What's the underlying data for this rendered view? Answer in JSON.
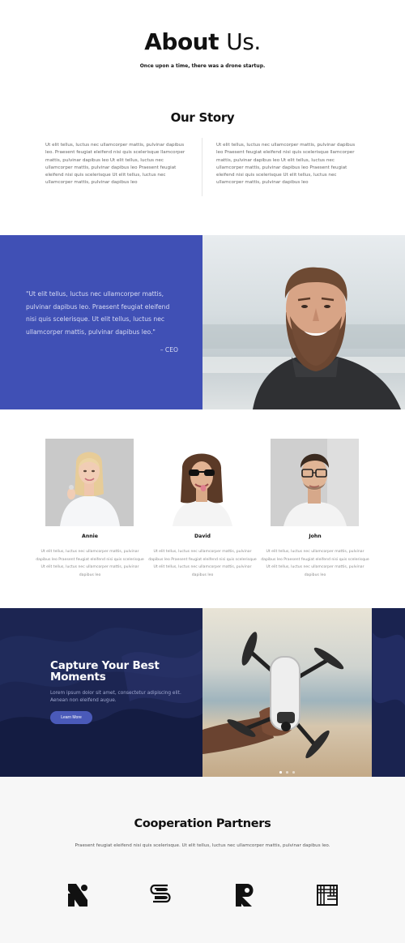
{
  "hero": {
    "title_bold": "About",
    "title_light": "Us.",
    "subtitle": "Once upon a time, there was a drone startup."
  },
  "story": {
    "title": "Our Story",
    "left_paragraph": "Ut elit tellus, luctus nec ullamcorper mattis, pulvinar dapibus leo. Praesent feugiat eleifend nisi quis scelerisque llamcorper mattis, pulvinar dapibus leo Ut elit tellus, luctus nec ullamcorper mattis, pulvinar dapibus leo Praesent feugiat eleifend nisi quis scelerisque Ut elit tellus, luctus nec ullamcorper mattis, pulvinar dapibus leo",
    "right_paragraph": "Ut elit tellus, luctus nec ullamcorper mattis, pulvinar dapibus leo Praesent feugiat eleifend nisi quis scelerisque llamcorper mattis, pulvinar dapibus leo Ut elit tellus, luctus nec ullamcorper mattis, pulvinar dapibus leo Praesent feugiat eleifend nisi quis scelerisque Ut elit tellus, luctus nec ullamcorper mattis, pulvinar dapibus leo"
  },
  "quote": {
    "text": "\"Ut elit tellus, luctus nec ullamcorper mattis, pulvinar dapibus leo. Praesent feugiat eleifend nisi quis scelerisque. Ut elit tellus, luctus nec ullamcorper mattis, pulvinar dapibus leo.\"",
    "author": "– CEO",
    "panel_color": "#4050b5"
  },
  "team": [
    {
      "name": "Annie",
      "bio": "Ut elit tellus, luctus nec ullamcorper mattis, pulvinar dapibus leo Praesent feugiat eleifend nisi quis scelerisque Ut elit tellus, luctus nec ullamcorper mattis, pulvinar dapibus leo"
    },
    {
      "name": "David",
      "bio": "Ut elit tellus, luctus nec ullamcorper mattis, pulvinar dapibus leo Praesent feugiat eleifend nisi quis scelerisque Ut elit tellus, luctus nec ullamcorper mattis, pulvinar dapibus leo"
    },
    {
      "name": "John",
      "bio": "Ut elit tellus, luctus nec ullamcorper mattis, pulvinar dapibus leo Praesent feugiat eleifend nisi quis scelerisque Ut elit tellus, luctus nec ullamcorper mattis, pulvinar dapibus leo"
    }
  ],
  "capture": {
    "title": "Capture Your Best Moments",
    "text": "Lorem ipsum dolor sit amet, consectetur adipiscing elit. Aenean non eleifend augue.",
    "button_label": "Learn More",
    "accent_color": "#4a5ab9",
    "background_color": "#1b2550",
    "slides_total": 3,
    "slide_active": 1
  },
  "partners": {
    "title": "Cooperation Partners",
    "text": "Praesent feugiat eleifend nisi quis scelerisque. Ut elit tellus, luctus nec ullamcorper mattis, pulvinar dapibus leo.",
    "logos": [
      "n-block-logo",
      "s-loop-logo",
      "r-block-logo",
      "square-lines-logo"
    ]
  }
}
